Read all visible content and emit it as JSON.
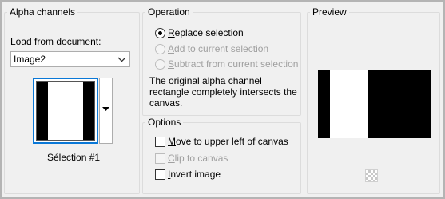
{
  "alpha_channels": {
    "title": "Alpha channels",
    "load_label": "Load from document:",
    "load_underline": "d",
    "document_selected": "Image2",
    "thumbnail_caption": "Sélection #1"
  },
  "operation": {
    "title": "Operation",
    "options": [
      {
        "label": "Replace selection",
        "checked": true,
        "enabled": true
      },
      {
        "label": "Add to current selection",
        "checked": false,
        "enabled": false
      },
      {
        "label": "Subtract from current selection",
        "checked": false,
        "enabled": false
      }
    ],
    "info_line1": "The original alpha channel",
    "info_line2": "rectangle completely intersects the",
    "info_line3": "canvas."
  },
  "options": {
    "title": "Options",
    "items": [
      {
        "label": "Move to upper left of canvas",
        "checked": false,
        "enabled": true
      },
      {
        "label": "Clip to canvas",
        "checked": false,
        "enabled": false
      },
      {
        "label": "Invert image",
        "checked": false,
        "enabled": true
      }
    ]
  },
  "preview": {
    "title": "Preview",
    "icon": "transparency-checker-icon"
  },
  "colors": {
    "accent": "#0a78d7",
    "disabled_text": "#a0a0a0",
    "panel_bg": "#f0f0f0"
  }
}
